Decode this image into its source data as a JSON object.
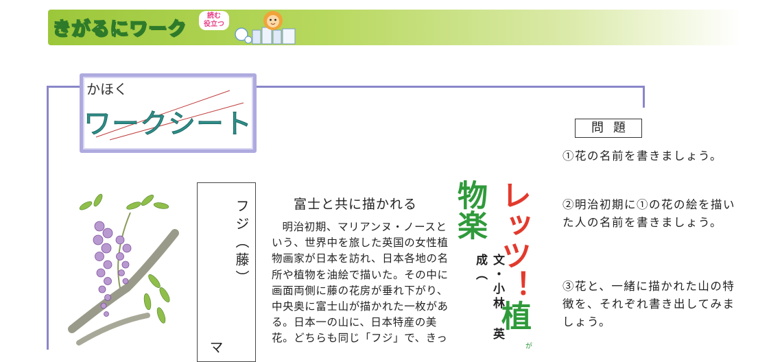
{
  "banner": {
    "title": "きがるにワーク",
    "sub_line1": "読む",
    "sub_line2": "役立つ"
  },
  "worksheet": {
    "label_small": "かほく",
    "label_big": "ワークシート"
  },
  "questions": {
    "header": "問題",
    "items": [
      "①花の名前を書きましょう。",
      "②明治初期に①の花の絵を描いた人の名前を書きましょう。",
      "③花と、一緒に描かれた山の特徴を、それぞれ書き出してみましょう。"
    ]
  },
  "plant_box": {
    "name": "フジ（藤）",
    "next": "マ"
  },
  "article": {
    "title": "富士と共に描かれる",
    "body": "明治初期、マリアンヌ・ノースという、世界中を旅した英国の女性植物画家が日本を訪れ、日本各地の名所や植物を油絵で描いた。その中に画面両側に藤の花房が垂れ下がり、中央奥に富士山が描かれた一枚がある。日本一の山に、日本特産の美花。どちらも同じ「フジ」で、きっ",
    "author": "文・小林 英成（"
  },
  "series": {
    "part1": "レッツ！",
    "part2": "植物楽",
    "small": "が"
  }
}
